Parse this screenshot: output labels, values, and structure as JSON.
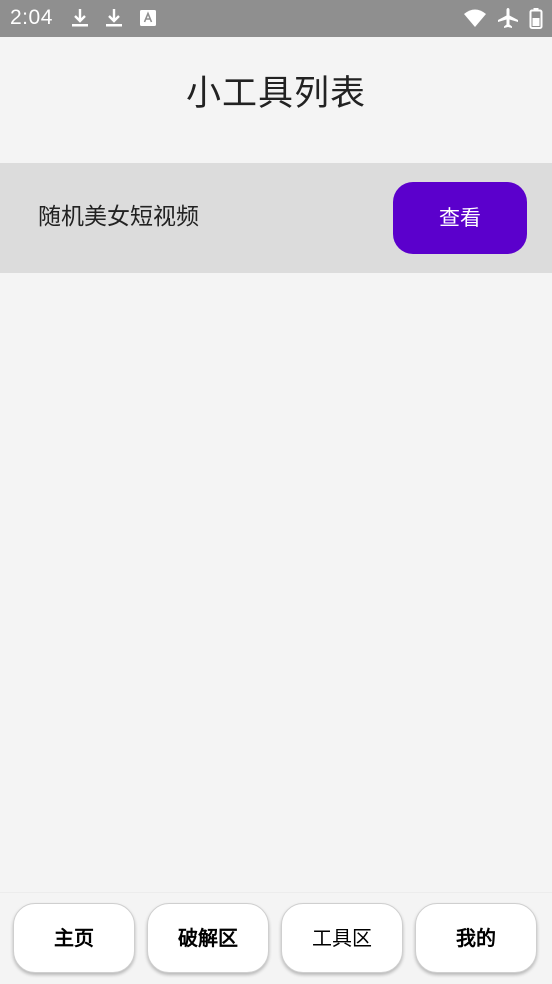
{
  "status_bar": {
    "time": "2:04",
    "left_icons": [
      "download-icon",
      "download-icon",
      "keyboard-a-icon"
    ],
    "right_icons": [
      "wifi-icon",
      "airplane-icon",
      "battery-icon"
    ]
  },
  "header": {
    "title": "小工具列表"
  },
  "tools": [
    {
      "name": "随机美女短视频",
      "action_label": "查看"
    }
  ],
  "bottom_nav": {
    "items": [
      {
        "label": "主页",
        "bold": true
      },
      {
        "label": "破解区",
        "bold": true
      },
      {
        "label": "工具区",
        "bold": false
      },
      {
        "label": "我的",
        "bold": true
      }
    ]
  },
  "colors": {
    "status_bar": "#8f8f8f",
    "background": "#f4f4f4",
    "tool_row": "#dcdcdc",
    "accent_button": "#5b00cc"
  }
}
